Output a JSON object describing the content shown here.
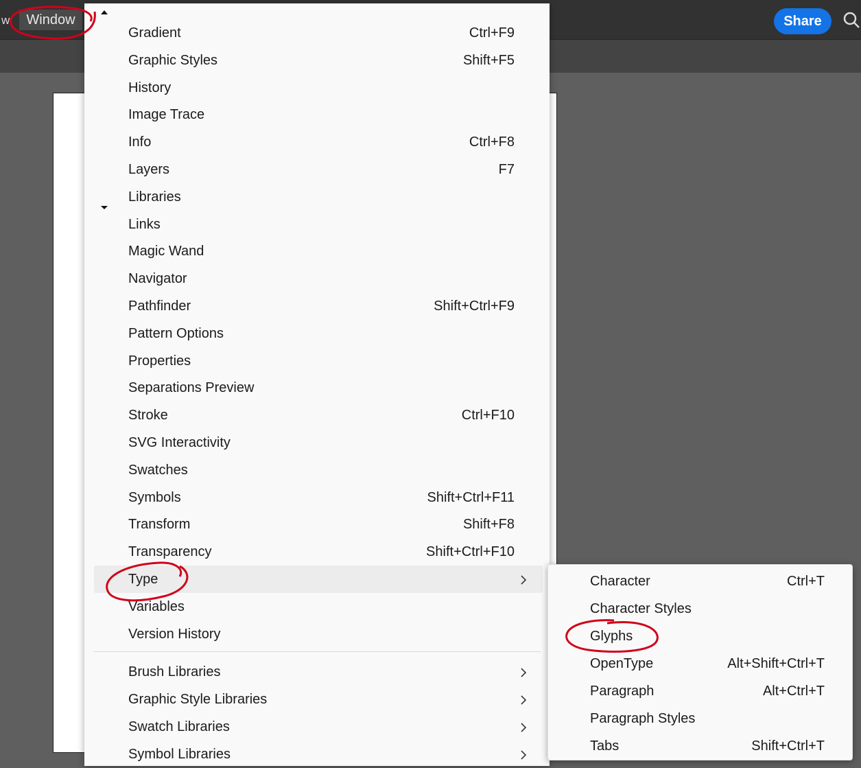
{
  "menubar": {
    "prev_menu_fragment": "w",
    "window_label": "Window",
    "share_label": "Share",
    "icons": {
      "search": "search-icon"
    }
  },
  "window_menu": {
    "items": [
      {
        "label": "Gradient",
        "shortcut": "Ctrl+F9"
      },
      {
        "label": "Graphic Styles",
        "shortcut": "Shift+F5"
      },
      {
        "label": "History",
        "shortcut": ""
      },
      {
        "label": "Image Trace",
        "shortcut": ""
      },
      {
        "label": "Info",
        "shortcut": "Ctrl+F8"
      },
      {
        "label": "Layers",
        "shortcut": "F7"
      },
      {
        "label": "Libraries",
        "shortcut": ""
      },
      {
        "label": "Links",
        "shortcut": ""
      },
      {
        "label": "Magic Wand",
        "shortcut": ""
      },
      {
        "label": "Navigator",
        "shortcut": ""
      },
      {
        "label": "Pathfinder",
        "shortcut": "Shift+Ctrl+F9"
      },
      {
        "label": "Pattern Options",
        "shortcut": ""
      },
      {
        "label": "Properties",
        "shortcut": ""
      },
      {
        "label": "Separations Preview",
        "shortcut": ""
      },
      {
        "label": "Stroke",
        "shortcut": "Ctrl+F10"
      },
      {
        "label": "SVG Interactivity",
        "shortcut": ""
      },
      {
        "label": "Swatches",
        "shortcut": ""
      },
      {
        "label": "Symbols",
        "shortcut": "Shift+Ctrl+F11"
      },
      {
        "label": "Transform",
        "shortcut": "Shift+F8"
      },
      {
        "label": "Transparency",
        "shortcut": "Shift+Ctrl+F10"
      },
      {
        "label": "Type",
        "shortcut": "",
        "submenu": true,
        "highlighted": true
      },
      {
        "label": "Variables",
        "shortcut": ""
      },
      {
        "label": "Version History",
        "shortcut": ""
      }
    ],
    "library_items": [
      {
        "label": "Brush Libraries",
        "submenu": true
      },
      {
        "label": "Graphic Style Libraries",
        "submenu": true
      },
      {
        "label": "Swatch Libraries",
        "submenu": true
      },
      {
        "label": "Symbol Libraries",
        "submenu": true
      }
    ]
  },
  "type_submenu": {
    "items": [
      {
        "label": "Character",
        "shortcut": "Ctrl+T"
      },
      {
        "label": "Character Styles",
        "shortcut": ""
      },
      {
        "label": "Glyphs",
        "shortcut": ""
      },
      {
        "label": "OpenType",
        "shortcut": "Alt+Shift+Ctrl+T"
      },
      {
        "label": "Paragraph",
        "shortcut": "Alt+Ctrl+T"
      },
      {
        "label": "Paragraph Styles",
        "shortcut": ""
      },
      {
        "label": "Tabs",
        "shortcut": "Shift+Ctrl+T"
      }
    ]
  },
  "colors": {
    "accent": "#1473e6",
    "annotation": "#d0021b",
    "menu_bg": "#f9f9f9",
    "canvas_bg": "#5f5f5f"
  }
}
